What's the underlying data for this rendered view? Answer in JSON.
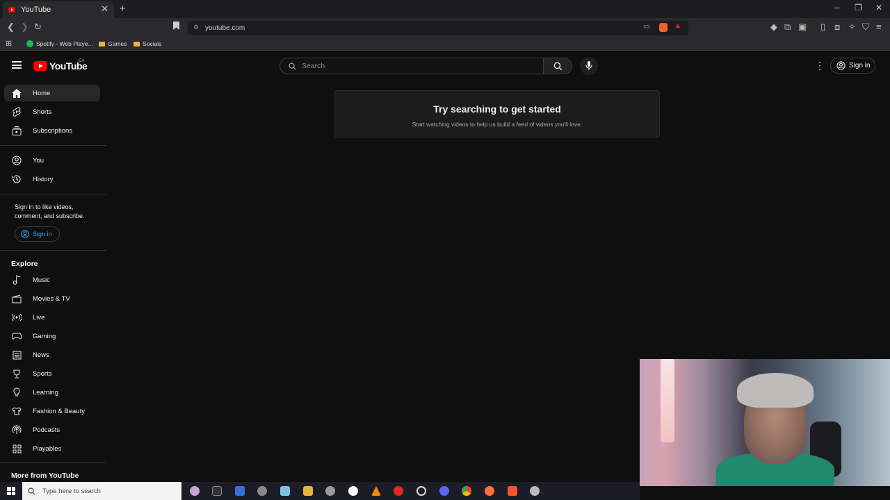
{
  "browser": {
    "tab_title": "YouTube",
    "url": "youtube.com",
    "bookmarks": [
      "Spotify - Web Playe...",
      "Games",
      "Socials"
    ]
  },
  "header": {
    "logo_text": "YouTube",
    "country_code": "CA",
    "search_placeholder": "Search",
    "sign_in_label": "Sign in"
  },
  "sidebar": {
    "primary": [
      {
        "label": "Home",
        "icon": "home-icon",
        "active": true
      },
      {
        "label": "Shorts",
        "icon": "shorts-icon"
      },
      {
        "label": "Subscriptions",
        "icon": "subscriptions-icon"
      }
    ],
    "you": [
      {
        "label": "You",
        "icon": "user-icon"
      },
      {
        "label": "History",
        "icon": "history-icon"
      }
    ],
    "signin_prompt": "Sign in to like videos, comment, and subscribe.",
    "signin_label": "Sign in",
    "explore_heading": "Explore",
    "explore": [
      {
        "label": "Music",
        "icon": "music-icon"
      },
      {
        "label": "Movies & TV",
        "icon": "movies-icon"
      },
      {
        "label": "Live",
        "icon": "live-icon"
      },
      {
        "label": "Gaming",
        "icon": "gaming-icon"
      },
      {
        "label": "News",
        "icon": "news-icon"
      },
      {
        "label": "Sports",
        "icon": "sports-icon"
      },
      {
        "label": "Learning",
        "icon": "learning-icon"
      },
      {
        "label": "Fashion & Beauty",
        "icon": "fashion-icon"
      },
      {
        "label": "Podcasts",
        "icon": "podcasts-icon"
      },
      {
        "label": "Playables",
        "icon": "playables-icon"
      }
    ],
    "more_heading": "More from YouTube"
  },
  "main": {
    "empty_title": "Try searching to get started",
    "empty_subtitle": "Start watching videos to help us build a feed of videos you'll love."
  },
  "taskbar": {
    "search_placeholder": "Type here to search"
  },
  "colors": {
    "background": "#0f0f0f",
    "accent_red": "#ff0000",
    "link_blue": "#3ea6ff"
  }
}
